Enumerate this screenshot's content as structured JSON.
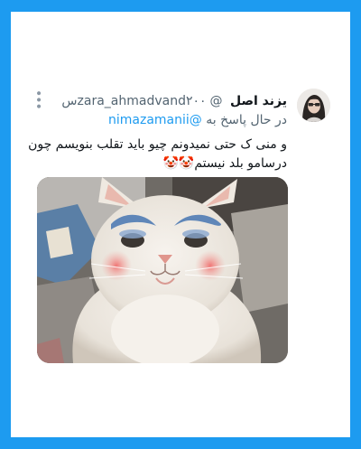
{
  "tweet": {
    "author_name": "یزند اصل",
    "author_handle": "@zara_ahmadvand",
    "time": "۲۰۰س",
    "reply_prefix": "در حال پاسخ به",
    "reply_to": "@nimazamanii",
    "text": "و منی ک حتی نمیدونم چیو باید تقلب بنویسم چون درسامو بلد نیستم🤡🤡",
    "avatar_icon": "profile-photo",
    "more_icon": "more-options-icon",
    "media_description": "cat-with-clown-makeup"
  },
  "colors": {
    "background": "#1d9bf0",
    "card": "#ffffff",
    "link": "#1d9bf0",
    "secondary_text": "#536471"
  }
}
